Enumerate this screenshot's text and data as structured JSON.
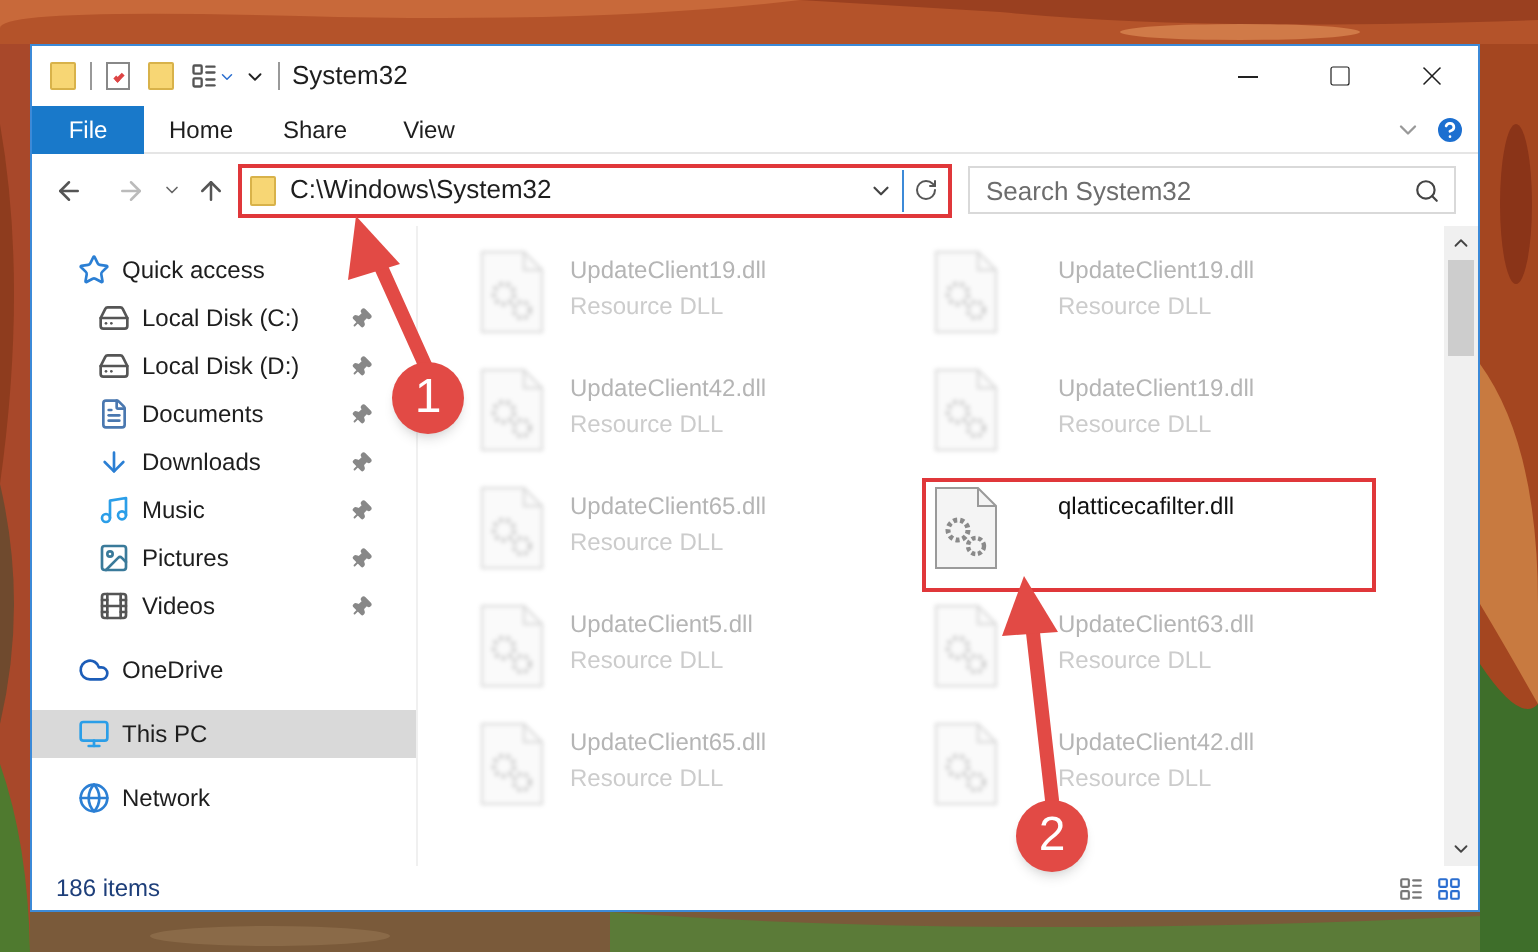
{
  "window": {
    "title": "System32"
  },
  "file_tab": "File",
  "ribbon_tabs": [
    {
      "label": "Home"
    },
    {
      "label": "Share"
    },
    {
      "label": "View"
    }
  ],
  "address_bar": {
    "path": "C:\\Windows\\System32",
    "highlighted": true
  },
  "search": {
    "placeholder": "Search System32"
  },
  "nav": [
    {
      "label": "Quick access",
      "kind": "star",
      "selected": false,
      "pinned": false,
      "indent": false
    },
    {
      "label": "Local Disk (C:)",
      "kind": "drive",
      "selected": false,
      "pinned": true,
      "indent": true
    },
    {
      "label": "Local Disk (D:)",
      "kind": "drive",
      "selected": false,
      "pinned": true,
      "indent": true
    },
    {
      "label": "Documents",
      "kind": "documents",
      "selected": false,
      "pinned": true,
      "indent": true
    },
    {
      "label": "Downloads",
      "kind": "downloads",
      "selected": false,
      "pinned": true,
      "indent": true
    },
    {
      "label": "Music",
      "kind": "music",
      "selected": false,
      "pinned": true,
      "indent": true
    },
    {
      "label": "Pictures",
      "kind": "pictures",
      "selected": false,
      "pinned": true,
      "indent": true
    },
    {
      "label": "Videos",
      "kind": "videos",
      "selected": false,
      "pinned": true,
      "indent": true
    },
    {
      "label": "OneDrive",
      "kind": "cloud",
      "selected": false,
      "pinned": false,
      "indent": false
    },
    {
      "label": "This PC",
      "kind": "pc",
      "selected": true,
      "pinned": false,
      "indent": false
    },
    {
      "label": "Network",
      "kind": "network",
      "selected": false,
      "pinned": false,
      "indent": false
    }
  ],
  "files": [
    {
      "name": "UpdateClient19.dll",
      "type": "Resource DLL",
      "dimmed": true,
      "highlighted": false
    },
    {
      "name": "UpdateClient19.dll",
      "type": "Resource DLL",
      "dimmed": true,
      "highlighted": false
    },
    {
      "name": "UpdateClient42.dll",
      "type": "Resource DLL",
      "dimmed": true,
      "highlighted": false
    },
    {
      "name": "UpdateClient19.dll",
      "type": "Resource DLL",
      "dimmed": true,
      "highlighted": false
    },
    {
      "name": "UpdateClient65.dll",
      "type": "Resource DLL",
      "dimmed": true,
      "highlighted": false
    },
    {
      "name": "qlatticecafilter.dll",
      "dimmed": false,
      "highlighted": true
    },
    {
      "name": "UpdateClient5.dll",
      "type": "Resource DLL",
      "dimmed": true,
      "highlighted": false
    },
    {
      "name": "UpdateClient63.dll",
      "type": "Resource DLL",
      "dimmed": true,
      "highlighted": false
    },
    {
      "name": "UpdateClient65.dll",
      "type": "Resource DLL",
      "dimmed": true,
      "highlighted": false
    },
    {
      "name": "UpdateClient42.dll",
      "type": "Resource DLL",
      "dimmed": true,
      "highlighted": false
    }
  ],
  "status_bar": "186 items",
  "callouts": [
    {
      "number": "1"
    },
    {
      "number": "2"
    }
  ]
}
